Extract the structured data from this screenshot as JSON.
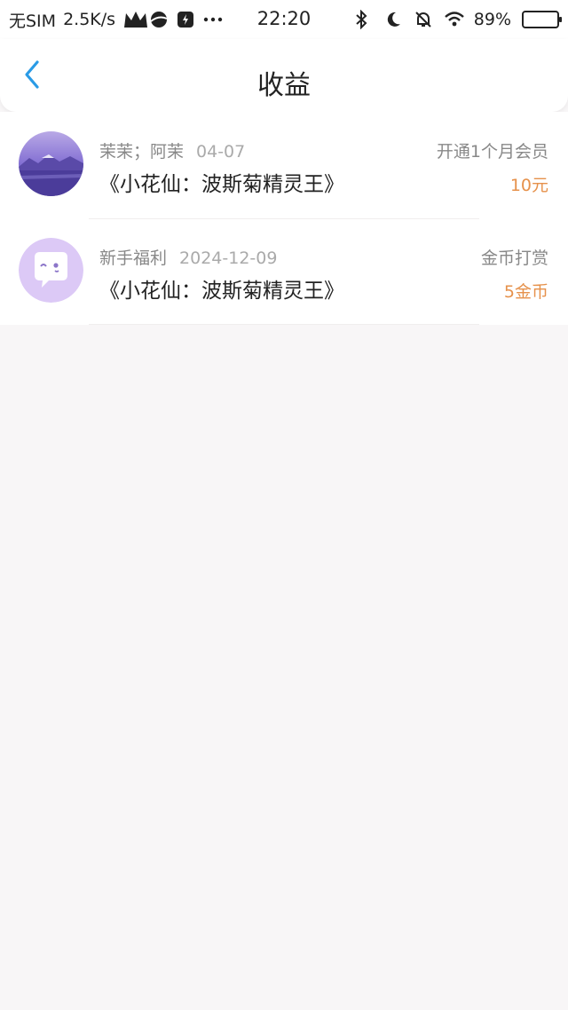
{
  "status_bar": {
    "carrier": "无SIM",
    "speed": "2.5K/s",
    "time": "22:20",
    "battery": "89%",
    "battery_level": 0.89
  },
  "header": {
    "title": "收益"
  },
  "items": [
    {
      "meta_name": "茉茉；阿茉",
      "date": "04-07",
      "book": "《小花仙：波斯菊精灵王》",
      "label": "开通1个月会员",
      "amount": "10元",
      "avatar": "landscape-photo"
    },
    {
      "meta_name": "新手福利",
      "date": "2024-12-09",
      "book": "《小花仙：波斯菊精灵王》",
      "label": "金币打赏",
      "amount": "5金币",
      "avatar": "chat-bubble-icon"
    }
  ],
  "colors": {
    "accent": "#2a9be6",
    "amount": "#e6914b",
    "background": "#f8f6f7"
  }
}
